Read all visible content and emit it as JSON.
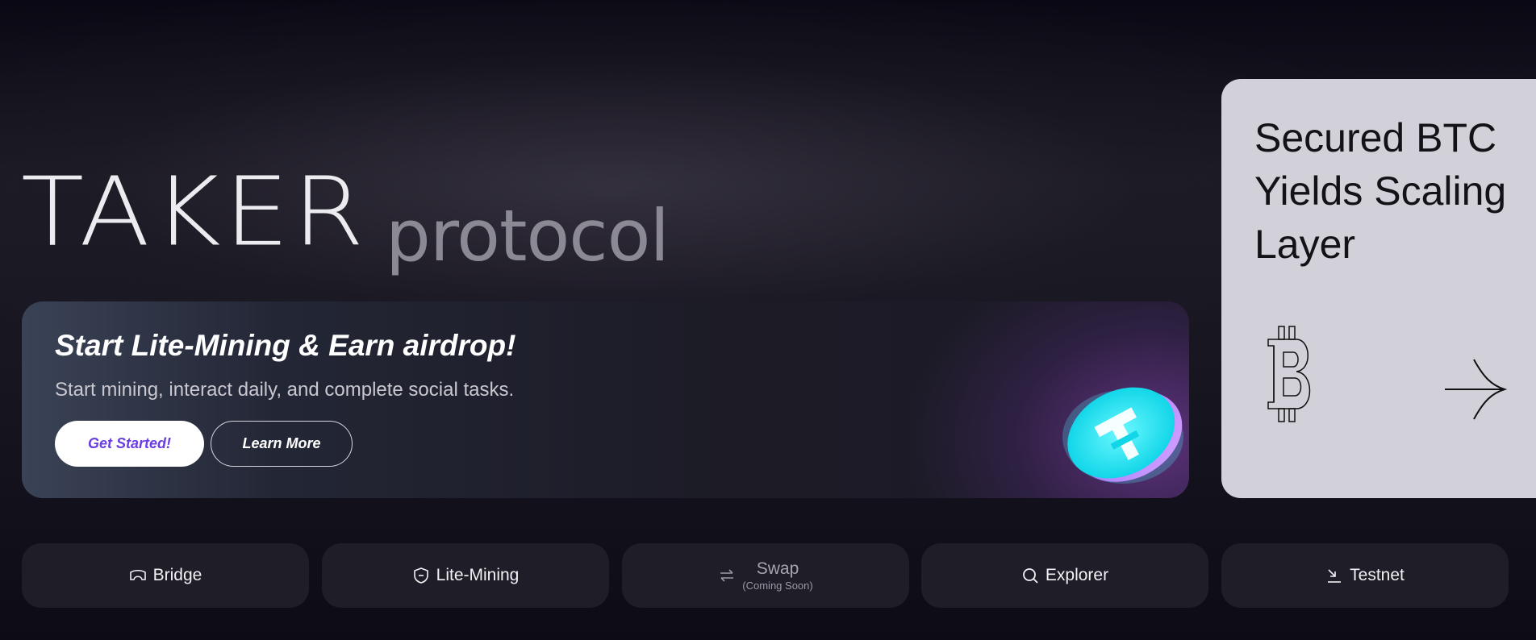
{
  "hero": {
    "brand_main": "TAKER",
    "brand_suffix": "protocol"
  },
  "promo": {
    "title": "Start Lite-Mining & Earn airdrop!",
    "subtitle": "Start mining, interact daily, and complete social tasks.",
    "primary_button": "Get Started!",
    "secondary_button": "Learn More",
    "coin_icon": "taker-coin-icon"
  },
  "feature_card": {
    "title_line1": "Secured BTC",
    "title_line2": "Yields Scaling",
    "title_line3": "Layer",
    "icon": "bitcoin-icon",
    "arrow_icon": "arrow-right-icon"
  },
  "nav": {
    "bridge": {
      "label": "Bridge",
      "icon": "bridge-icon"
    },
    "lite_mining": {
      "label": "Lite-Mining",
      "icon": "shield-icon"
    },
    "swap": {
      "label": "Swap",
      "note": "(Coming Soon)",
      "icon": "swap-icon"
    },
    "explorer": {
      "label": "Explorer",
      "icon": "search-icon"
    },
    "testnet": {
      "label": "Testnet",
      "icon": "download-icon"
    }
  },
  "colors": {
    "accent": "#6a3ee0",
    "card_bg": "#d2d1da",
    "coin": "#2ff0f0"
  }
}
